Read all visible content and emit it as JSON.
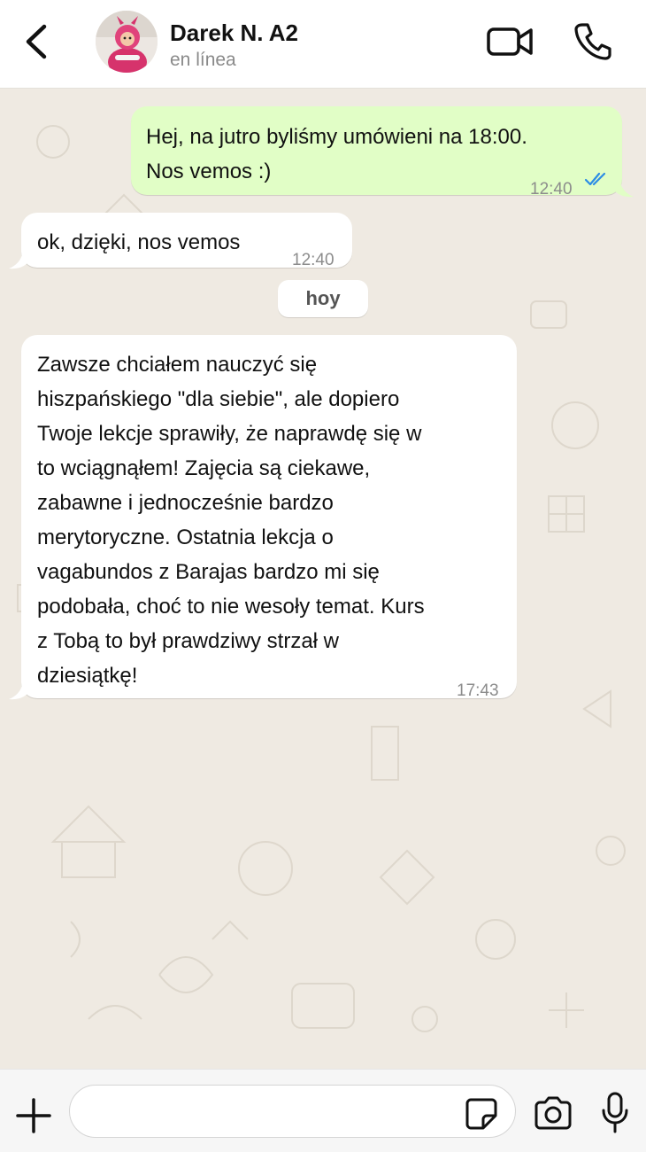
{
  "header": {
    "contact_name": "Darek N. A2",
    "status": "en línea",
    "icons": {
      "back": "chevron-left-icon",
      "video": "video-camera-icon",
      "call": "phone-icon"
    }
  },
  "messages": [
    {
      "direction": "outgoing",
      "lines": [
        "Hej, na jutro byliśmy umówieni na  18:00.",
        "Nos vemos :)"
      ],
      "time": "12:40",
      "status": "read-double-check"
    },
    {
      "direction": "incoming",
      "lines": [
        "ok, dzięki, nos vemos"
      ],
      "time": "12:40"
    },
    {
      "direction": "incoming",
      "lines": [
        "Zawsze chciałem nauczyć się",
        "hiszpańskiego \"dla siebie\", ale dopiero",
        "Twoje lekcje sprawiły, że naprawdę się w",
        "to wciągnąłem! Zajęcia są ciekawe,",
        "zabawne i jednocześnie bardzo",
        "merytoryczne. Ostatnia lekcja o",
        "vagabundos z Barajas bardzo mi się",
        "podobała, choć to nie wesoły temat. Kurs",
        "z Tobą to był prawdziwy strzał w",
        "dziesiątkę!"
      ],
      "time": "17:43"
    }
  ],
  "date_separator": "hoy",
  "input_bar": {
    "placeholder": "",
    "value": "",
    "icons": {
      "plus": "plus-icon",
      "sticker": "sticker-icon",
      "camera": "camera-icon",
      "mic": "microphone-icon"
    }
  },
  "colors": {
    "outgoing_bubble": "#e1fec6",
    "incoming_bubble": "#ffffff",
    "chat_background": "#efeae2",
    "read_ticks": "#2b8ce5"
  }
}
